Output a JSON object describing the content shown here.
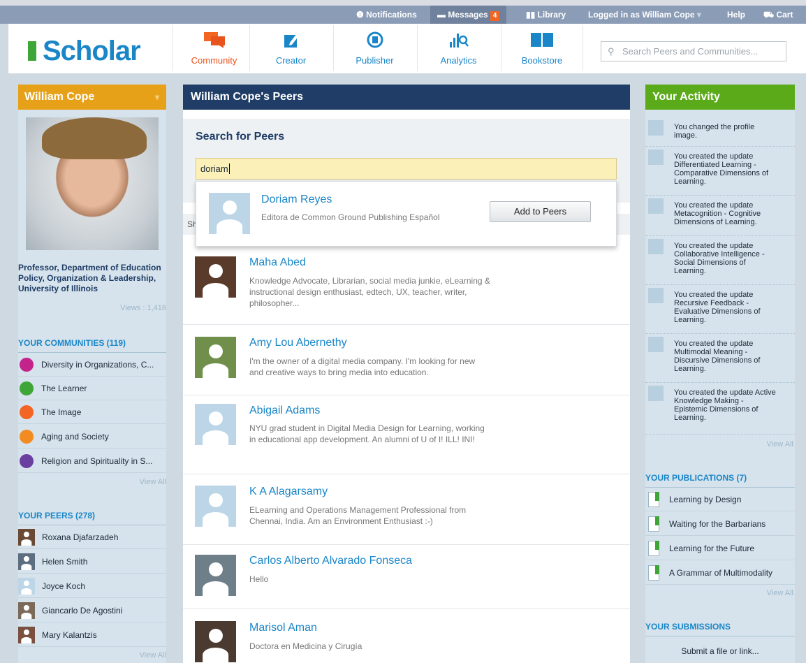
{
  "topbar": {
    "notifications": "Notifications",
    "messages": "Messages",
    "messages_count": "4",
    "library": "Library",
    "logged_in": "Logged in as William Cope",
    "help": "Help",
    "cart": "Cart"
  },
  "brand": {
    "name": "Scholar"
  },
  "nav": [
    {
      "label": "Community"
    },
    {
      "label": "Creator"
    },
    {
      "label": "Publisher"
    },
    {
      "label": "Analytics"
    },
    {
      "label": "Bookstore"
    }
  ],
  "search": {
    "placeholder": "Search Peers and Communities..."
  },
  "profile": {
    "name": "William Cope",
    "title": "Professor, Department of Education Policy, Organization & Leadership, University of Illinois",
    "views": "Views : 1,418"
  },
  "communities": {
    "heading": "YOUR COMMUNITIES (119)",
    "items": [
      "Diversity in Organizations, C...",
      "The Learner",
      "The Image",
      "Aging and Society",
      "Religion and Spirituality in S..."
    ],
    "colors": [
      "#c4238c",
      "#3ea538",
      "#f26522",
      "#f28c22",
      "#6a3fa0"
    ],
    "view_all": "View All"
  },
  "peers_side": {
    "heading": "YOUR PEERS (278)",
    "items": [
      "Roxana Djafarzadeh",
      "Helen Smith",
      "Joyce Koch",
      "Giancarlo De Agostini",
      "Mary Kalantzis"
    ],
    "view_all": "View All"
  },
  "main": {
    "title": "William Cope's Peers",
    "search_heading": "Search for Peers",
    "search_value": "doriam",
    "show_prefix": "Sh"
  },
  "dropdown": {
    "name": "Doriam Reyes",
    "desc": "Editora de Common Ground Publishing Español",
    "button": "Add to Peers"
  },
  "peers": [
    {
      "name": "Maha Abed",
      "desc": "Knowledge Advocate, Librarian, social media junkie, eLearning & instructional design enthusiast, edtech, UX, teacher, writer, philosopher..."
    },
    {
      "name": "Amy Lou Abernethy",
      "desc": "I'm the owner of a digital media company. I'm looking for new and creative ways to bring media into education."
    },
    {
      "name": "Abigail Adams",
      "desc": "NYU grad student in Digital Media Design for Learning, working in educational app development. An alumni of U of I! ILL! INI!"
    },
    {
      "name": "K A Alagarsamy",
      "desc": "ELearning and Operations Management Professional from Chennai, India. Am an Environment Enthusiast :-)"
    },
    {
      "name": "Carlos Alberto Alvarado Fonseca",
      "desc": "Hello"
    },
    {
      "name": "Marisol Aman",
      "desc": "Doctora en Medicina y Cirugía"
    }
  ],
  "activity": {
    "title": "Your Activity",
    "items": [
      "You changed the profile image.",
      "You created the update Differentiated Learning - Comparative Dimensions of Learning.",
      "You created the update Metacognition - Cognitive Dimensions of Learning.",
      "You created the update Collaborative Intelligence - Social Dimensions of Learning.",
      "You created the update Recursive Feedback - Evaluative Dimensions of Learning.",
      "You created the update Multimodal Meaning - Discursive Dimensions of Learning.",
      "You created the update Active Knowledge Making - Epistemic Dimensions of Learning."
    ],
    "view_all": "View All"
  },
  "publications": {
    "heading": "YOUR PUBLICATIONS (7)",
    "items": [
      "Learning by Design",
      "Waiting for the Barbarians",
      "Learning for the Future",
      "A Grammar of Multimodality"
    ],
    "view_all": "View All"
  },
  "submissions": {
    "heading": "YOUR SUBMISSIONS",
    "action": "Submit a file or link..."
  }
}
